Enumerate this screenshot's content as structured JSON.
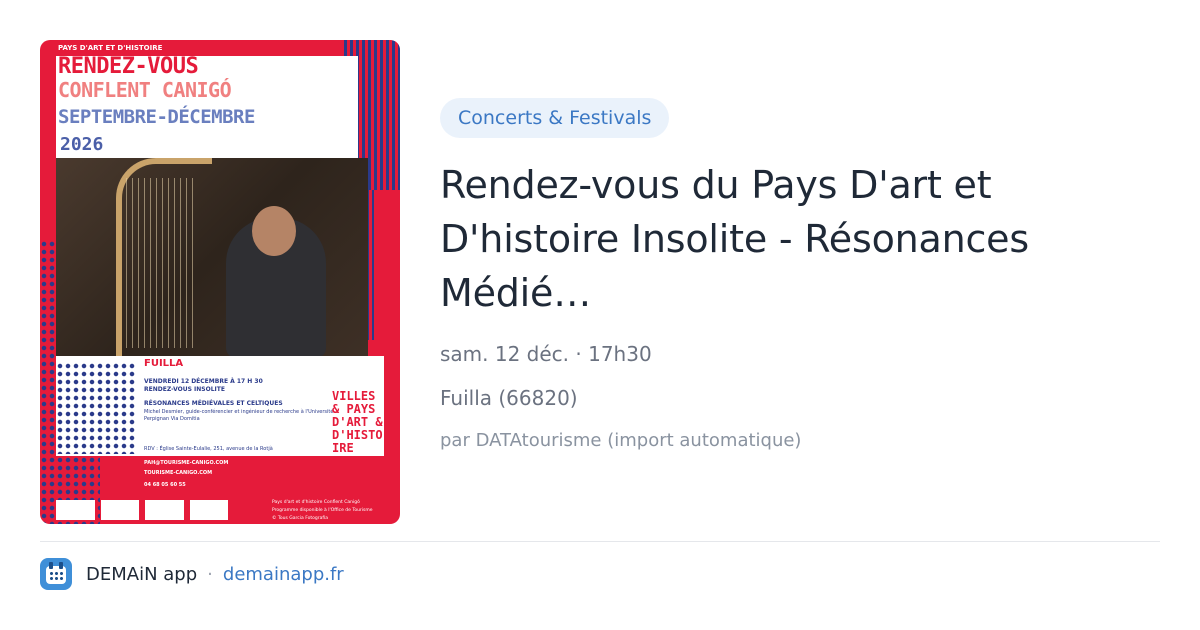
{
  "poster": {
    "kicker": "PAYS D'ART ET D'HISTOIRE",
    "line1": "RENDEZ-VOUS",
    "line2": "CONFLENT CANIGÓ",
    "line3": "SEPTEMBRE-DÉCEMBRE",
    "line4": "2026",
    "place": "FUILLA",
    "date_line": "VENDREDI 12 DÉCEMBRE À 17 H 30",
    "type_line": "RENDEZ-VOUS INSOLITE",
    "event_line": "RÉSONANCES MÉDIÉVALES ET CELTIQUES",
    "speaker_line": "Michel Desmier, guide-conférencier et ingénieur de recherche à l'Université",
    "speaker_line2": "Perpignan Via Domitia",
    "address_line": "RDV : Église Sainte-Eulalie, 251, avenue de la Rotjà",
    "email": "PAH@TOURISME-CANIGO.COM",
    "site": "TOURISME-CANIGO.COM",
    "phone": "04 68 05 60 55",
    "villes": [
      "VILLES",
      "& PAYS",
      "D'ART &",
      "D'HISTO",
      "IRE"
    ],
    "credit1": "Pays d'art et d'histoire Conflent Canigó",
    "credit2": "Programme disponible à l'Office de Tourisme",
    "credit3": "© Tous Garcia Fotografia"
  },
  "card": {
    "category": "Concerts & Festivals",
    "title": "Rendez-vous du Pays D'art et D'histoire Insolite - Résonances Médié…",
    "datetime": "sam. 12 déc. · 17h30",
    "location": "Fuilla (66820)",
    "source": "par DATAtourisme (import automatique)"
  },
  "footer": {
    "app_name": "DEMAiN app",
    "separator": "·",
    "domain": "demainapp.fr"
  },
  "colors": {
    "poster_red": "#e51b3a",
    "poster_blue": "#2a3a8a",
    "badge_bg": "#eaf2fb",
    "link_blue": "#3b78c4"
  }
}
